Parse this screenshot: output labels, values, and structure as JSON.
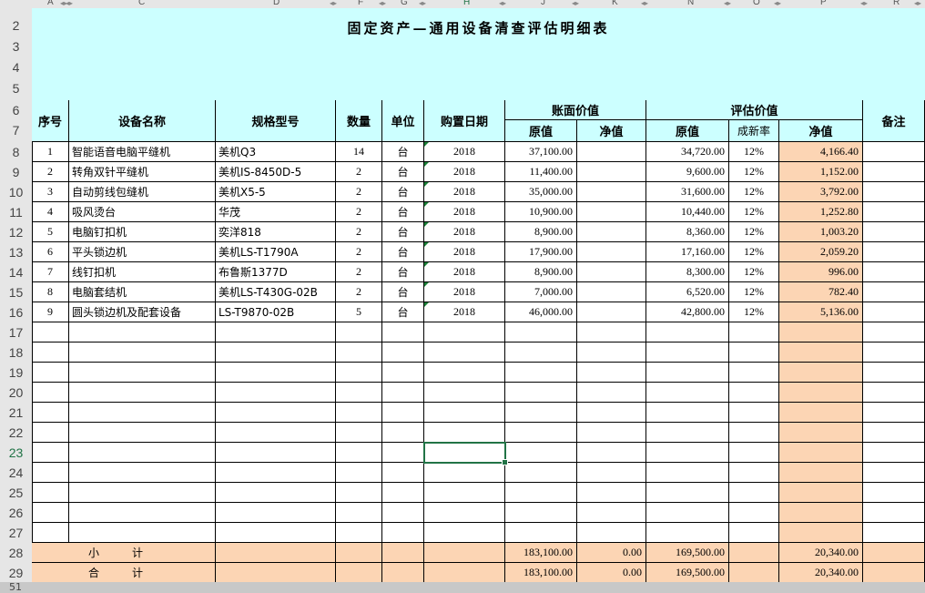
{
  "column_headers": [
    "A",
    "C",
    "D",
    "F",
    "G",
    "H",
    "J",
    "K",
    "N",
    "O",
    "P",
    "R"
  ],
  "row_numbers": [
    "2",
    "3",
    "4",
    "5",
    "6",
    "7",
    "8",
    "9",
    "10",
    "11",
    "12",
    "13",
    "14",
    "15",
    "16",
    "17",
    "18",
    "19",
    "20",
    "21",
    "22",
    "23",
    "24",
    "25",
    "26",
    "27",
    "28",
    "29",
    "51"
  ],
  "selected_row": "23",
  "title": "固定资产—通用设备清查评估明细表",
  "headers": {
    "seq": "序号",
    "name": "设备名称",
    "model": "规格型号",
    "qty": "数量",
    "unit": "单位",
    "date": "购置日期",
    "book_value": "账面价值",
    "book_orig": "原值",
    "book_net": "净值",
    "eval_value": "评估价值",
    "eval_orig": "原值",
    "eval_rate": "成新率",
    "eval_net": "净值",
    "remark": "备注"
  },
  "rows": [
    {
      "seq": "1",
      "name": "智能语音电脑平缝机",
      "model": "美机Q3",
      "qty": "14",
      "unit": "台",
      "date": "2018",
      "book_orig": "37,100.00",
      "book_net": "",
      "eval_orig": "34,720.00",
      "rate": "12%",
      "eval_net": "4,166.40",
      "remark": ""
    },
    {
      "seq": "2",
      "name": "转角双针平缝机",
      "model": "美机IS-8450D-5",
      "qty": "2",
      "unit": "台",
      "date": "2018",
      "book_orig": "11,400.00",
      "book_net": "",
      "eval_orig": "9,600.00",
      "rate": "12%",
      "eval_net": "1,152.00",
      "remark": ""
    },
    {
      "seq": "3",
      "name": "自动剪线包缝机",
      "model": "美机X5-5",
      "qty": "2",
      "unit": "台",
      "date": "2018",
      "book_orig": "35,000.00",
      "book_net": "",
      "eval_orig": "31,600.00",
      "rate": "12%",
      "eval_net": "3,792.00",
      "remark": ""
    },
    {
      "seq": "4",
      "name": "吸风烫台",
      "model": "华茂",
      "qty": "2",
      "unit": "台",
      "date": "2018",
      "book_orig": "10,900.00",
      "book_net": "",
      "eval_orig": "10,440.00",
      "rate": "12%",
      "eval_net": "1,252.80",
      "remark": ""
    },
    {
      "seq": "5",
      "name": "电脑钉扣机",
      "model": "奕洋818",
      "qty": "2",
      "unit": "台",
      "date": "2018",
      "book_orig": "8,900.00",
      "book_net": "",
      "eval_orig": "8,360.00",
      "rate": "12%",
      "eval_net": "1,003.20",
      "remark": ""
    },
    {
      "seq": "6",
      "name": "平头锁边机",
      "model": "美机LS-T1790A",
      "qty": "2",
      "unit": "台",
      "date": "2018",
      "book_orig": "17,900.00",
      "book_net": "",
      "eval_orig": "17,160.00",
      "rate": "12%",
      "eval_net": "2,059.20",
      "remark": ""
    },
    {
      "seq": "7",
      "name": "线钉扣机",
      "model": "布鲁斯1377D",
      "qty": "2",
      "unit": "台",
      "date": "2018",
      "book_orig": "8,900.00",
      "book_net": "",
      "eval_orig": "8,300.00",
      "rate": "12%",
      "eval_net": "996.00",
      "remark": ""
    },
    {
      "seq": "8",
      "name": "电脑套结机",
      "model": "美机LS-T430G-02B",
      "qty": "2",
      "unit": "台",
      "date": "2018",
      "book_orig": "7,000.00",
      "book_net": "",
      "eval_orig": "6,520.00",
      "rate": "12%",
      "eval_net": "782.40",
      "remark": ""
    },
    {
      "seq": "9",
      "name": "圆头锁边机及配套设备",
      "model": "LS-T9870-02B",
      "qty": "5",
      "unit": "台",
      "date": "2018",
      "book_orig": "46,000.00",
      "book_net": "",
      "eval_orig": "42,800.00",
      "rate": "12%",
      "eval_net": "5,136.00",
      "remark": ""
    }
  ],
  "subtotal": {
    "label": "小　　　计",
    "book_orig": "183,100.00",
    "book_net": "0.00",
    "eval_orig": "169,500.00",
    "eval_net": "20,340.00"
  },
  "total": {
    "label": "合　　　计",
    "book_orig": "183,100.00",
    "book_net": "0.00",
    "eval_orig": "169,500.00",
    "eval_net": "20,340.00"
  },
  "colors": {
    "header_bg": "#ccffff",
    "highlight": "#fcd5b4",
    "selection": "#217346"
  }
}
